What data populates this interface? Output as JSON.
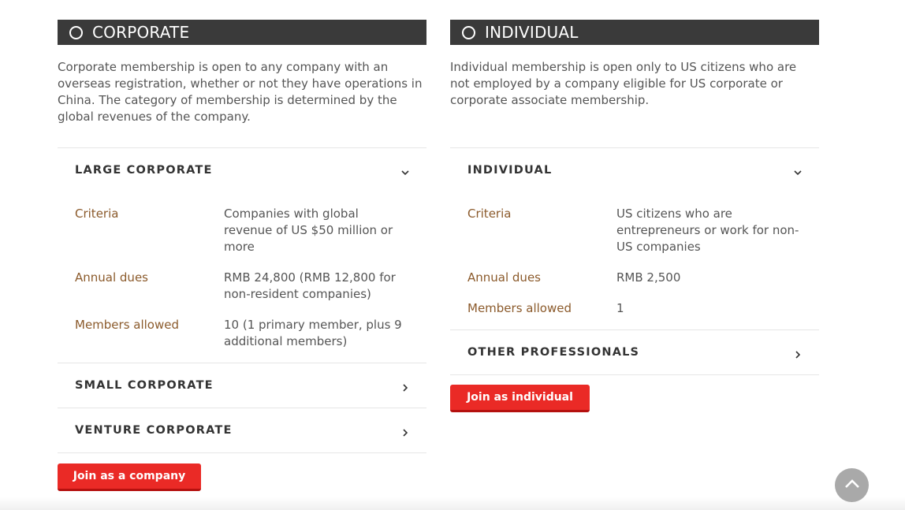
{
  "corporate": {
    "title": "CORPORATE",
    "intro": "Corporate membership is open to any company with an overseas registration, whether or not they have operations in China. The category of membership is determined by the global revenues of the company.",
    "sections": [
      {
        "title": "LARGE CORPORATE",
        "expanded": true,
        "rows": [
          {
            "label": "Criteria",
            "value": "Companies with global revenue of US $50 million or more"
          },
          {
            "label": "Annual dues",
            "value": "RMB 24,800 (RMB 12,800 for non-resident companies)"
          },
          {
            "label": "Members allowed",
            "value": "10 (1 primary member, plus 9 additional members)"
          }
        ]
      },
      {
        "title": "SMALL CORPORATE",
        "expanded": false
      },
      {
        "title": "VENTURE CORPORATE",
        "expanded": false
      }
    ],
    "button": "Join as a company"
  },
  "individual": {
    "title": "INDIVIDUAL",
    "intro": "Individual membership is open only to US citizens who are not employed by a company eligible for US corporate or corporate associate membership.",
    "sections": [
      {
        "title": "INDIVIDUAL",
        "expanded": true,
        "rows": [
          {
            "label": "Criteria",
            "value": "US citizens who are entrepreneurs or work for non-US companies"
          },
          {
            "label": "Annual dues",
            "value": "RMB 2,500"
          },
          {
            "label": "Members allowed",
            "value": "1"
          }
        ]
      },
      {
        "title": "OTHER PROFESSIONALS",
        "expanded": false
      }
    ],
    "button": "Join as individual"
  },
  "icons": {
    "header": "radio-circle-icon",
    "expanded": "chevron-down-icon",
    "collapsed": "chevron-right-icon",
    "scroll": "chevron-up-icon"
  },
  "colors": {
    "header_bg": "#3a3a3a",
    "label": "#8b5a2b",
    "button": "#ea2a26",
    "scroll_button": "#a9a9a9"
  }
}
